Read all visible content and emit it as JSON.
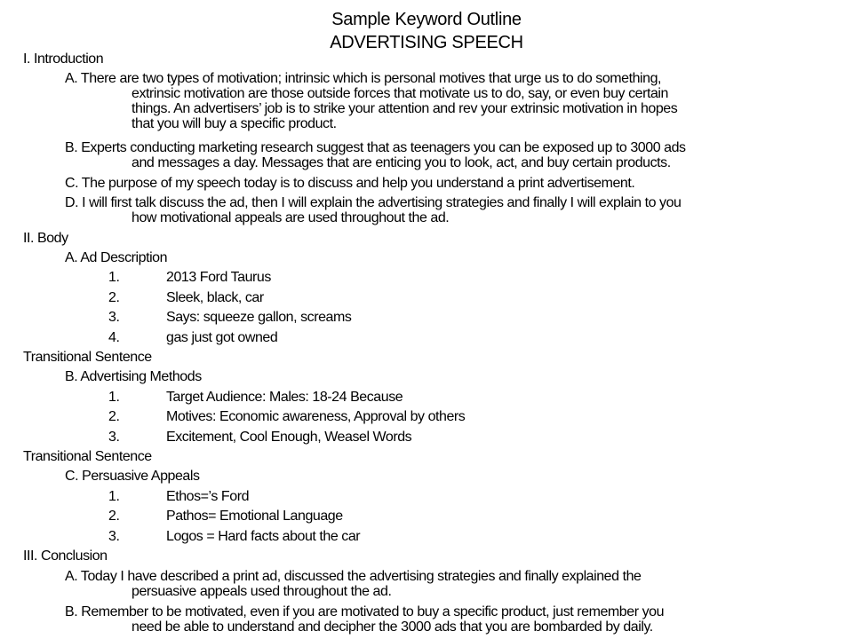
{
  "title": "Sample Keyword Outline",
  "subtitle": "ADVERTISING SPEECH",
  "introduction": {
    "heading": "I. Introduction",
    "A": [
      "A. There are two types of motivation; intrinsic which is personal motives that urge us to do something,",
      "extrinsic motivation are those outside forces that motivate us to do, say, or even buy certain",
      "things.  An advertisers’ job is to strike your attention and rev your extrinsic motivation in hopes",
      "that you will buy a specific product."
    ],
    "B": [
      "B. Experts conducting marketing research suggest that as teenagers you can be exposed up to 3000 ads",
      "and messages a day.  Messages that are enticing you to look, act, and buy certain products."
    ],
    "C": [
      "C. The purpose of my speech today is to discuss and help you understand a print advertisement."
    ],
    "D": [
      "D. I will first talk discuss the ad, then I  will explain the advertising strategies and finally I will explain to you",
      "how motivational appeals are used throughout the ad."
    ]
  },
  "body": {
    "heading": "II. Body",
    "A": {
      "label": "A. Ad Description",
      "items": [
        {
          "num": "1.",
          "text": "2013 Ford Taurus"
        },
        {
          "num": "2.",
          "text": "Sleek, black, car"
        },
        {
          "num": "3.",
          "text": "Says: squeeze gallon, screams"
        },
        {
          "num": "4.",
          "text": "gas just got owned"
        }
      ]
    },
    "transition1": "Transitional Sentence",
    "B": {
      "label": "B. Advertising Methods",
      "items": [
        {
          "num": "1.",
          "text": "Target Audience: Males: 18-24 Because"
        },
        {
          "num": "2.",
          "text": "Motives: Economic awareness, Approval by others"
        },
        {
          "num": "3.",
          "text": "Excitement, Cool Enough, Weasel Words"
        }
      ]
    },
    "transition2": "Transitional Sentence",
    "C": {
      "label": "C. Persuasive Appeals",
      "items": [
        {
          "num": "1.",
          "text": "Ethos=’s Ford"
        },
        {
          "num": "2.",
          "text": "Pathos= Emotional Language"
        },
        {
          "num": "3.",
          "text": "Logos = Hard facts about the car"
        }
      ]
    }
  },
  "conclusion": {
    "heading": "III. Conclusion",
    "A": [
      "A. Today I have described a print ad, discussed the advertising strategies and finally explained the",
      "persuasive appeals used throughout the ad."
    ],
    "B": [
      "B. Remember to be motivated, even if you are motivated to buy a specific product, just remember you",
      "need be able to understand and decipher the 3000 ads that you are bombarded by daily."
    ]
  }
}
